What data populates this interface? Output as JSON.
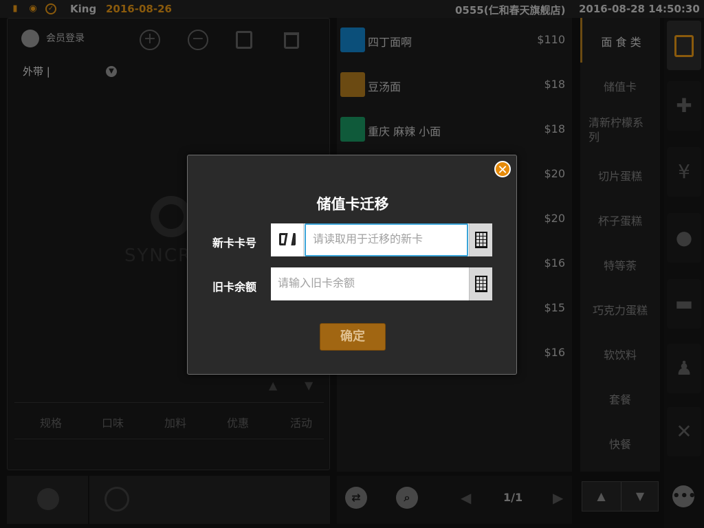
{
  "status_bar": {
    "user": "King",
    "business_date": "2016-08-26",
    "store": "0555(仁和春天旗舰店)",
    "datetime": "2016-08-28 14:50:30",
    "icons": [
      "signal-icon",
      "eye-icon",
      "check-circle-icon"
    ]
  },
  "left_panel": {
    "member_login": "会员登录",
    "order_type": "外带 |",
    "toolbar_icons": [
      "plus-circle-icon",
      "minus-circle-icon",
      "edit-icon",
      "trash-icon"
    ],
    "watermark_text": "SYNCR",
    "tabs": [
      "规格",
      "口味",
      "加料",
      "优惠",
      "活动"
    ]
  },
  "items": [
    {
      "name": "四丁面啊",
      "price": "$110",
      "color": "#0b4f7a"
    },
    {
      "name": "豆汤面",
      "price": "$18",
      "color": "#6b4a12"
    },
    {
      "name": "重庆 麻辣 小面",
      "price": "$18",
      "color": "#0f5a3a"
    },
    {
      "name": "",
      "price": "$20",
      "color": ""
    },
    {
      "name": "",
      "price": "$20",
      "color": ""
    },
    {
      "name": "",
      "price": "$16",
      "color": ""
    },
    {
      "name": "",
      "price": "$15",
      "color": ""
    },
    {
      "name": "",
      "price": "$16",
      "color": ""
    }
  ],
  "categories": [
    {
      "label": "面 食 类",
      "active": true
    },
    {
      "label": "储值卡"
    },
    {
      "label": "清新柠檬系列"
    },
    {
      "label": "切片蛋糕"
    },
    {
      "label": "杯子蛋糕"
    },
    {
      "label": "特等荼"
    },
    {
      "label": "巧克力蛋糕"
    },
    {
      "label": "软饮料"
    },
    {
      "label": "套餐"
    },
    {
      "label": "快餐"
    }
  ],
  "pager": {
    "text": "1/1"
  },
  "right_bar_icons": [
    "clipboard-icon",
    "pin-icon",
    "ticket-yen-icon",
    "bell-icon",
    "drawer-icon",
    "user-icon",
    "close-icon"
  ],
  "dialog": {
    "title": "储值卡迁移",
    "new_card_label": "新卡卡号",
    "new_card_placeholder": "请读取用于迁移的新卡",
    "old_balance_label": "旧卡余额",
    "old_balance_placeholder": "请输入旧卡余额",
    "confirm": "确定",
    "close_symbol": "✕"
  }
}
